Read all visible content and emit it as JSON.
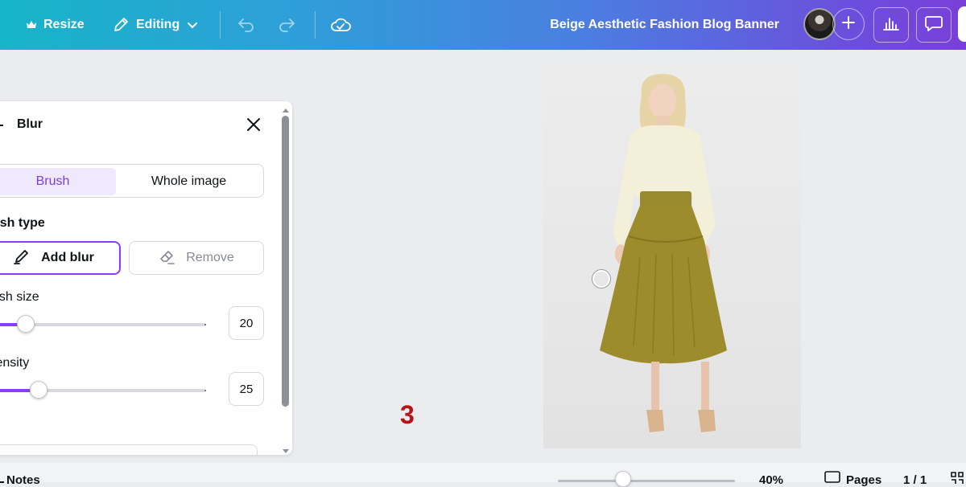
{
  "topbar": {
    "resize_label": "Resize",
    "resize_icon": "crown-icon",
    "mode_label": "Editing",
    "mode_icon": "pencil-icon",
    "undo_icon": "undo-icon",
    "redo_icon": "redo-icon",
    "sync_icon": "cloud-check-icon",
    "document_title": "Beige Aesthetic Fashion Blog Banner",
    "add_collaborator_icon": "plus-icon",
    "insights_icon": "bar-chart-icon",
    "comments_icon": "comment-icon"
  },
  "panel": {
    "title": "Blur",
    "mode_tabs": [
      "Brush",
      "Whole image"
    ],
    "active_tab": "Brush",
    "brush_type_label": "ush type",
    "add_blur_label": "Add blur",
    "remove_label": "Remove",
    "brush_size_label": "ush size",
    "brush_size_value": "20",
    "brush_size_fraction": 0.16,
    "intensity_label": "tensity",
    "intensity_value": "25",
    "intensity_fraction": 0.22
  },
  "canvas": {
    "step_number": "3"
  },
  "bottombar": {
    "notes_label": "Notes",
    "zoom_label": "40%",
    "pages_label": "Pages",
    "page_count": "1 / 1",
    "zoom_fraction": 0.37
  },
  "colors": {
    "accent": "#8b3dff",
    "step_number": "#b8131a"
  }
}
